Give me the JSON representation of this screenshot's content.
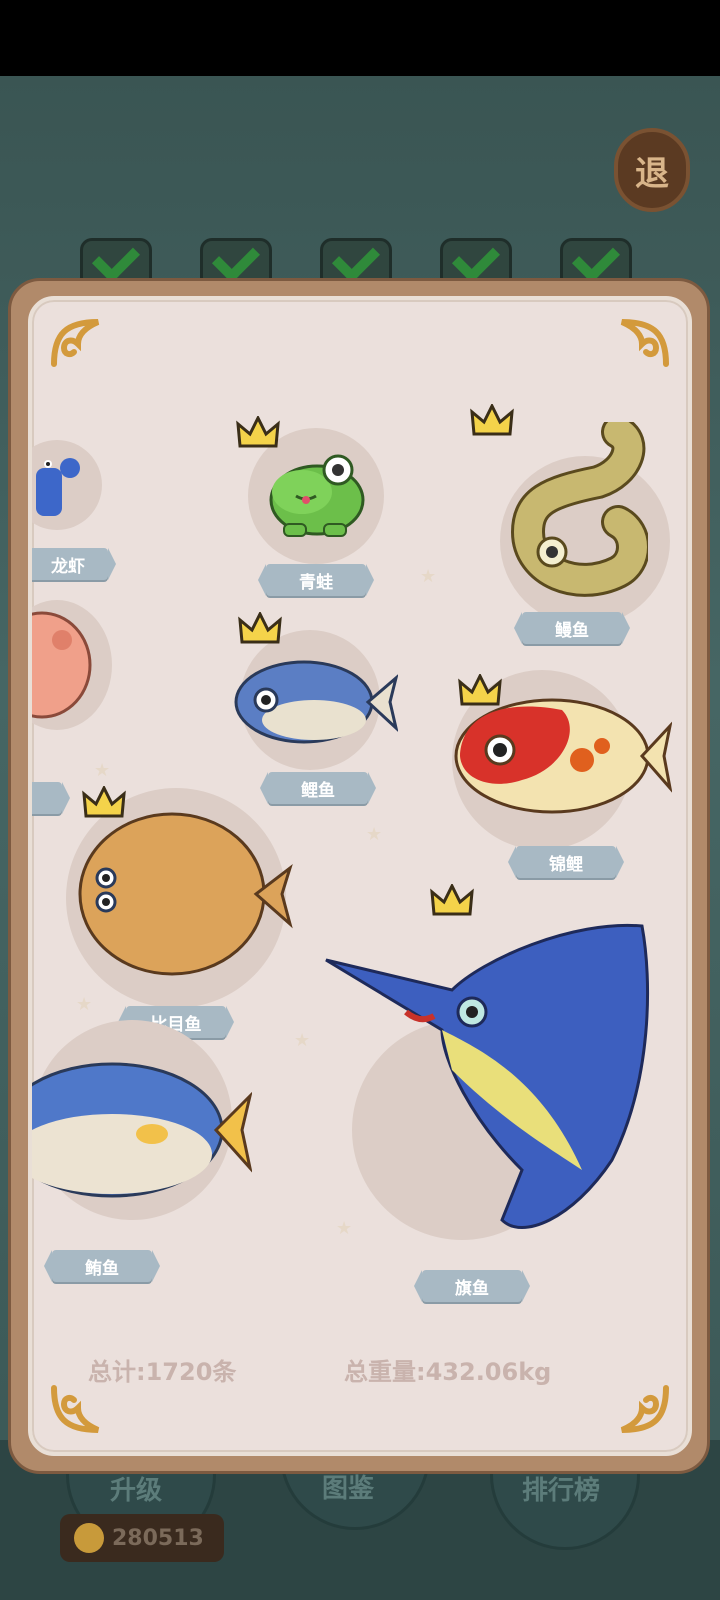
{
  "exit_button": {
    "label": "退"
  },
  "tabs": [
    "check",
    "check",
    "check",
    "check",
    "check"
  ],
  "fish": [
    {
      "name": "龙虾",
      "crowned": false
    },
    {
      "name": "青蛙",
      "crowned": true
    },
    {
      "name": "鳗鱼",
      "crowned": true
    },
    {
      "name": "鲤鱼",
      "crowned": true
    },
    {
      "name": "锦鲤",
      "crowned": true
    },
    {
      "name": "比目鱼",
      "crowned": true
    },
    {
      "name": "鲔鱼",
      "crowned": false
    },
    {
      "name": "旗鱼",
      "crowned": true
    }
  ],
  "stats": {
    "total_count": "总计:1720条",
    "total_weight": "总重量:432.06kg"
  },
  "bottom_nav": {
    "upgrade": "升级",
    "collection": "图鉴",
    "leaderboard": "排行榜",
    "coins": "280513"
  },
  "colors": {
    "panel_bg": "#ebe0dc",
    "frame": "#b18a6a",
    "tag": "#a8b9c4",
    "crown": "#f4d34a"
  }
}
